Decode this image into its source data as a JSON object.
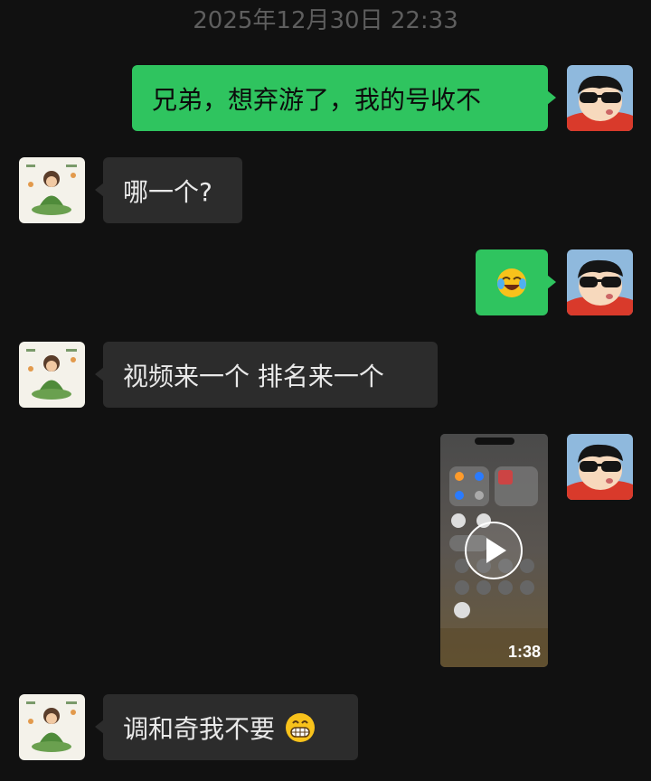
{
  "timestamp": "2025年12月30日 22:33",
  "messages": [
    {
      "from": "me",
      "text": "兄弟，想弃游了，我的号收不"
    },
    {
      "from": "other",
      "text": "哪一个?"
    },
    {
      "from": "me",
      "emoji": "face-with-tears-of-joy"
    },
    {
      "from": "other",
      "text": "视频来一个 排名来一个"
    },
    {
      "from": "me",
      "video_duration": "1:38"
    },
    {
      "from": "other",
      "text": "调和奇我不要",
      "emoji": "grinning-face"
    }
  ],
  "colors": {
    "background": "#111111",
    "outgoing_bubble": "#2fc45f",
    "incoming_bubble": "#2c2c2c"
  }
}
